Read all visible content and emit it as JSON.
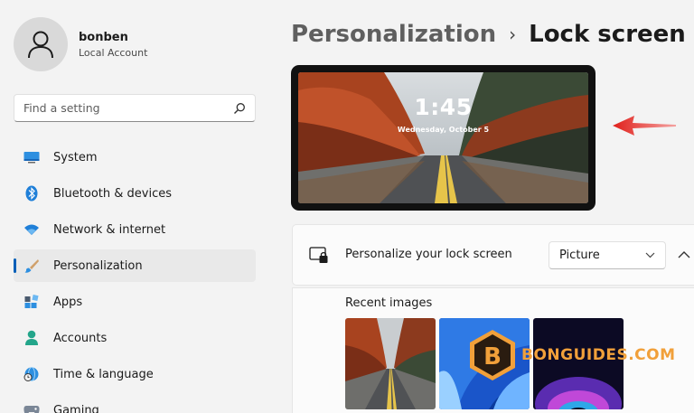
{
  "profile": {
    "name": "bonben",
    "account_type": "Local Account"
  },
  "search": {
    "placeholder": "Find a setting",
    "icon": "search-icon"
  },
  "sidebar": {
    "items": [
      {
        "label": "System",
        "icon": "system-icon",
        "active": false
      },
      {
        "label": "Bluetooth & devices",
        "icon": "bluetooth-icon",
        "active": false
      },
      {
        "label": "Network & internet",
        "icon": "wifi-icon",
        "active": false
      },
      {
        "label": "Personalization",
        "icon": "brush-icon",
        "active": true
      },
      {
        "label": "Apps",
        "icon": "apps-icon",
        "active": false
      },
      {
        "label": "Accounts",
        "icon": "person-icon",
        "active": false
      },
      {
        "label": "Time & language",
        "icon": "globe-clock-icon",
        "active": false
      },
      {
        "label": "Gaming",
        "icon": "gamepad-icon",
        "active": false
      }
    ]
  },
  "breadcrumb": {
    "parent": "Personalization",
    "separator": "›",
    "current": "Lock screen"
  },
  "preview": {
    "time": "1:45",
    "date": "Wednesday, October 5"
  },
  "lock_screen": {
    "label": "Personalize your lock screen",
    "value": "Picture",
    "recent_title": "Recent images"
  },
  "watermark": {
    "letter": "B",
    "text": "BONGUIDES.COM"
  },
  "colors": {
    "accent": "#005fb8",
    "arrow": "#e0201b",
    "watermark": "#f1a03a"
  }
}
